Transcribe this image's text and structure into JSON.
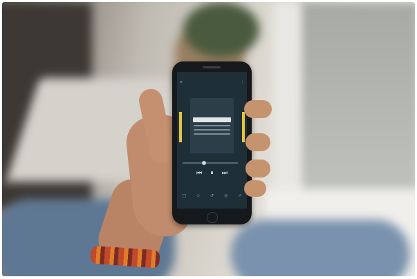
{
  "scene": {
    "description_label": "",
    "colors": {
      "phone_screen": "#1f2f38",
      "accent_gauge": "#e5c53e",
      "accent_header": "#9fd0d9"
    }
  },
  "phone": {
    "icons": {
      "menu": "menu-icon",
      "more": "more-icon",
      "previous": "skip-back-icon",
      "play_pause": "pause-icon",
      "next": "skip-forward-icon",
      "caption": "caption-icon",
      "bookmark": "bookmark-icon",
      "rewind": "rewind-icon",
      "speed": "speed-icon",
      "share": "share-icon"
    }
  }
}
